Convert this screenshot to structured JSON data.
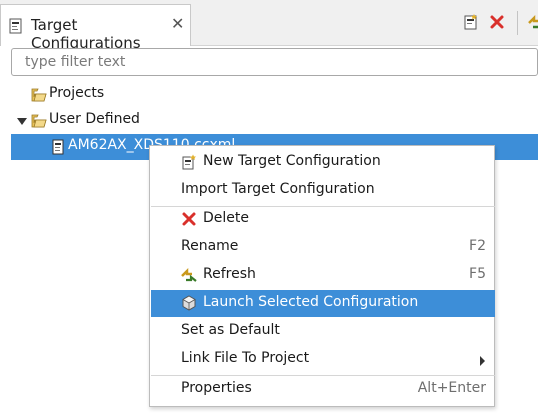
{
  "view": {
    "tab_title": "Target Configurations",
    "tab_icon": "target-config-icon",
    "close_glyph": "✕",
    "toolbar_icons": [
      "new-target-config-icon",
      "delete-icon",
      "refresh-icon"
    ]
  },
  "filter": {
    "placeholder": "type filter text",
    "value": ""
  },
  "tree": {
    "projects_label": "Projects",
    "user_defined_label": "User Defined",
    "ccxml_label": "AM62AX_XDS110.ccxml"
  },
  "menu": {
    "new_target": "New Target Configuration",
    "import_target": "Import Target Configuration",
    "delete": "Delete",
    "rename": "Rename",
    "rename_accel": "F2",
    "refresh": "Refresh",
    "refresh_accel": "F5",
    "launch": "Launch Selected Configuration",
    "set_default": "Set as Default",
    "link_file": "Link File To Project",
    "properties": "Properties",
    "properties_accel": "Alt+Enter"
  },
  "colors": {
    "selection": "#3d8ed8",
    "delete_red": "#d9302b",
    "folder_yellow": "#e8c25a"
  }
}
